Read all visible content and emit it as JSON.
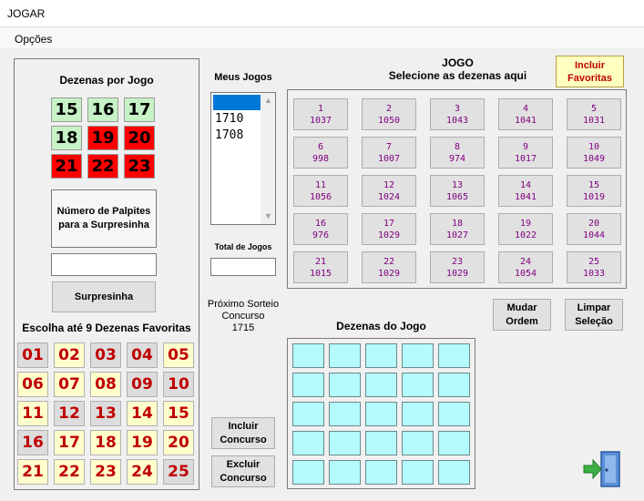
{
  "window": {
    "title": "JOGAR"
  },
  "menu": {
    "opcoes": "Opções"
  },
  "left": {
    "dezenas_title": "Dezenas por Jogo",
    "dezenas": [
      {
        "n": "15",
        "color": "green"
      },
      {
        "n": "16",
        "color": "green"
      },
      {
        "n": "17",
        "color": "green"
      },
      {
        "n": "18",
        "color": "green"
      },
      {
        "n": "19",
        "color": "red"
      },
      {
        "n": "20",
        "color": "red"
      },
      {
        "n": "21",
        "color": "red"
      },
      {
        "n": "22",
        "color": "red"
      },
      {
        "n": "23",
        "color": "red"
      }
    ],
    "palpites_label": "Número de Palpites para a Surpresinha",
    "palpites_value": "",
    "surpresinha_button": "Surpresinha",
    "favoritas_title": "Escolha até 9 Dezenas Favoritas",
    "favoritas": [
      {
        "n": "01",
        "state": "gray"
      },
      {
        "n": "02",
        "state": "yellow"
      },
      {
        "n": "03",
        "state": "gray"
      },
      {
        "n": "04",
        "state": "gray"
      },
      {
        "n": "05",
        "state": "yellow"
      },
      {
        "n": "06",
        "state": "yellow"
      },
      {
        "n": "07",
        "state": "yellow"
      },
      {
        "n": "08",
        "state": "yellow"
      },
      {
        "n": "09",
        "state": "gray"
      },
      {
        "n": "10",
        "state": "gray"
      },
      {
        "n": "11",
        "state": "yellow"
      },
      {
        "n": "12",
        "state": "gray"
      },
      {
        "n": "13",
        "state": "gray"
      },
      {
        "n": "14",
        "state": "yellow"
      },
      {
        "n": "15",
        "state": "yellow"
      },
      {
        "n": "16",
        "state": "gray"
      },
      {
        "n": "17",
        "state": "yellow"
      },
      {
        "n": "18",
        "state": "yellow"
      },
      {
        "n": "19",
        "state": "yellow"
      },
      {
        "n": "20",
        "state": "yellow"
      },
      {
        "n": "21",
        "state": "yellow"
      },
      {
        "n": "22",
        "state": "yellow"
      },
      {
        "n": "23",
        "state": "yellow"
      },
      {
        "n": "24",
        "state": "yellow"
      },
      {
        "n": "25",
        "state": "gray"
      }
    ]
  },
  "middle": {
    "meus_jogos_title": "Meus Jogos",
    "list_items": [
      "",
      "1710",
      "1708"
    ],
    "total_label": "Total de Jogos",
    "total_value": "",
    "proximo_sorteio": "Próximo Sorteio",
    "concurso_label": "Concurso",
    "concurso_number": "1715",
    "incluir_concurso": "Incluir Concurso",
    "excluir_concurso": "Excluir Concurso"
  },
  "game": {
    "title_line1": "JOGO",
    "title_line2": "Selecione as dezenas aqui",
    "incluir_favoritas": "Incluir Favoritas",
    "buttons": [
      {
        "n": "1",
        "c": "1037"
      },
      {
        "n": "2",
        "c": "1050"
      },
      {
        "n": "3",
        "c": "1043"
      },
      {
        "n": "4",
        "c": "1041"
      },
      {
        "n": "5",
        "c": "1031"
      },
      {
        "n": "6",
        "c": "998"
      },
      {
        "n": "7",
        "c": "1007"
      },
      {
        "n": "8",
        "c": "974"
      },
      {
        "n": "9",
        "c": "1017"
      },
      {
        "n": "10",
        "c": "1049"
      },
      {
        "n": "11",
        "c": "1056"
      },
      {
        "n": "12",
        "c": "1024"
      },
      {
        "n": "13",
        "c": "1065"
      },
      {
        "n": "14",
        "c": "1041"
      },
      {
        "n": "15",
        "c": "1019"
      },
      {
        "n": "16",
        "c": "976"
      },
      {
        "n": "17",
        "c": "1029"
      },
      {
        "n": "18",
        "c": "1027"
      },
      {
        "n": "19",
        "c": "1022"
      },
      {
        "n": "20",
        "c": "1044"
      },
      {
        "n": "21",
        "c": "1015"
      },
      {
        "n": "22",
        "c": "1029"
      },
      {
        "n": "23",
        "c": "1029"
      },
      {
        "n": "24",
        "c": "1054"
      },
      {
        "n": "25",
        "c": "1033"
      }
    ],
    "mudar_ordem": "Mudar Ordem",
    "limpar_selecao": "Limpar Seleção",
    "dezenas_do_jogo_title": "Dezenas do Jogo"
  },
  "icons": {
    "exit": "exit-door-icon"
  },
  "colors": {
    "green": "#c6f2c6",
    "red": "#ff0000",
    "fav_yellow": "#ffffcc",
    "fav_gray": "#dcdcdc",
    "cell": "#b5fbfd",
    "purple_text": "#800080",
    "fav_text": "#c00000"
  }
}
